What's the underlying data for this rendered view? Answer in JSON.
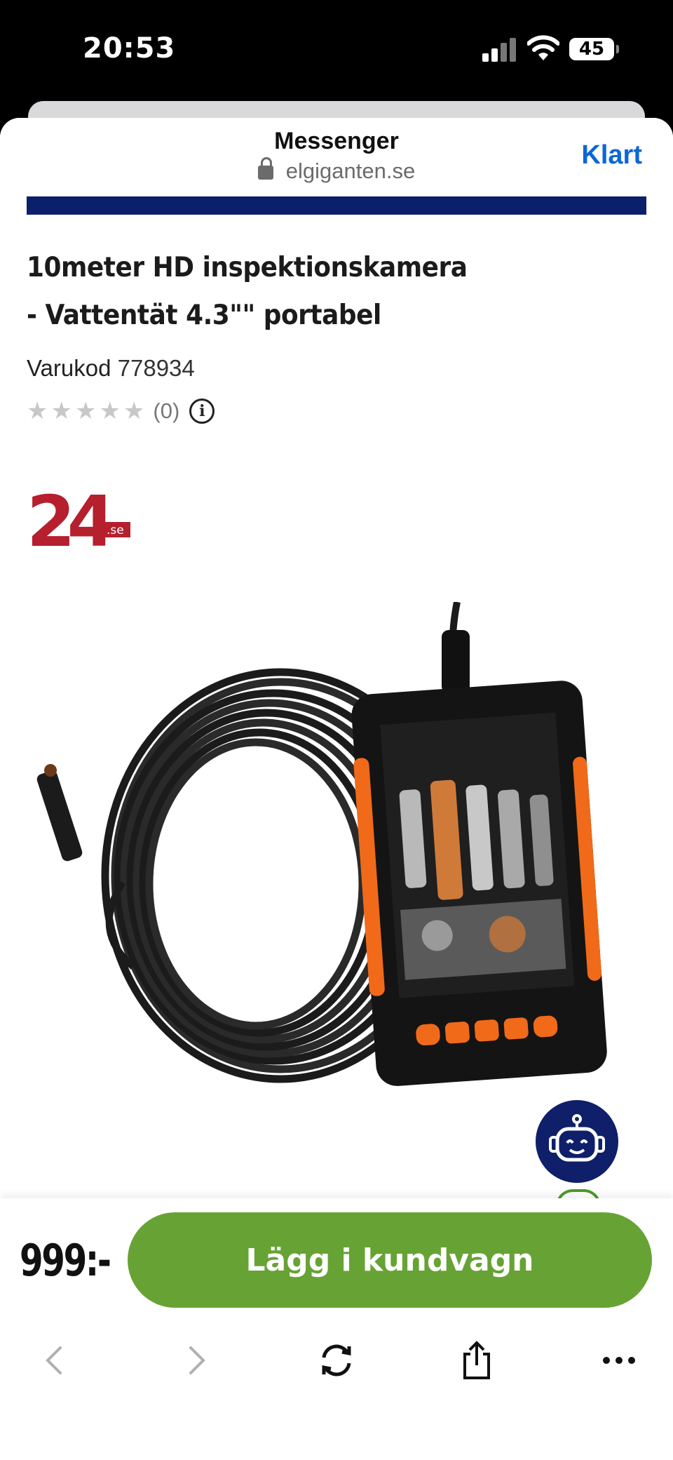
{
  "status_bar": {
    "time": "20:53",
    "battery": "45"
  },
  "browser": {
    "app_title": "Messenger",
    "url": "elgiganten.se",
    "done_label": "Klart"
  },
  "product": {
    "title_line1": "10meter HD inspektionskamera",
    "title_line2": "- Vattentät 4.3\"\" portabel",
    "sku_label": "Varukod",
    "sku_value": "778934",
    "rating_count": "(0)",
    "stars_filled": 0,
    "stars_total": 5
  },
  "seller": {
    "logo_text": "24",
    "logo_suffix": ".se",
    "brand_color": "#b51f2e"
  },
  "buy_bar": {
    "price": "999:-",
    "add_to_cart_label": "Lägg i kundvagn"
  },
  "colors": {
    "accent_green": "#67a334",
    "nav_blue": "#0b1f6b",
    "link_blue": "#0a67d6"
  },
  "toolbar": {
    "icons": [
      "back-icon",
      "forward-icon",
      "reload-icon",
      "share-icon",
      "more-icon"
    ]
  }
}
